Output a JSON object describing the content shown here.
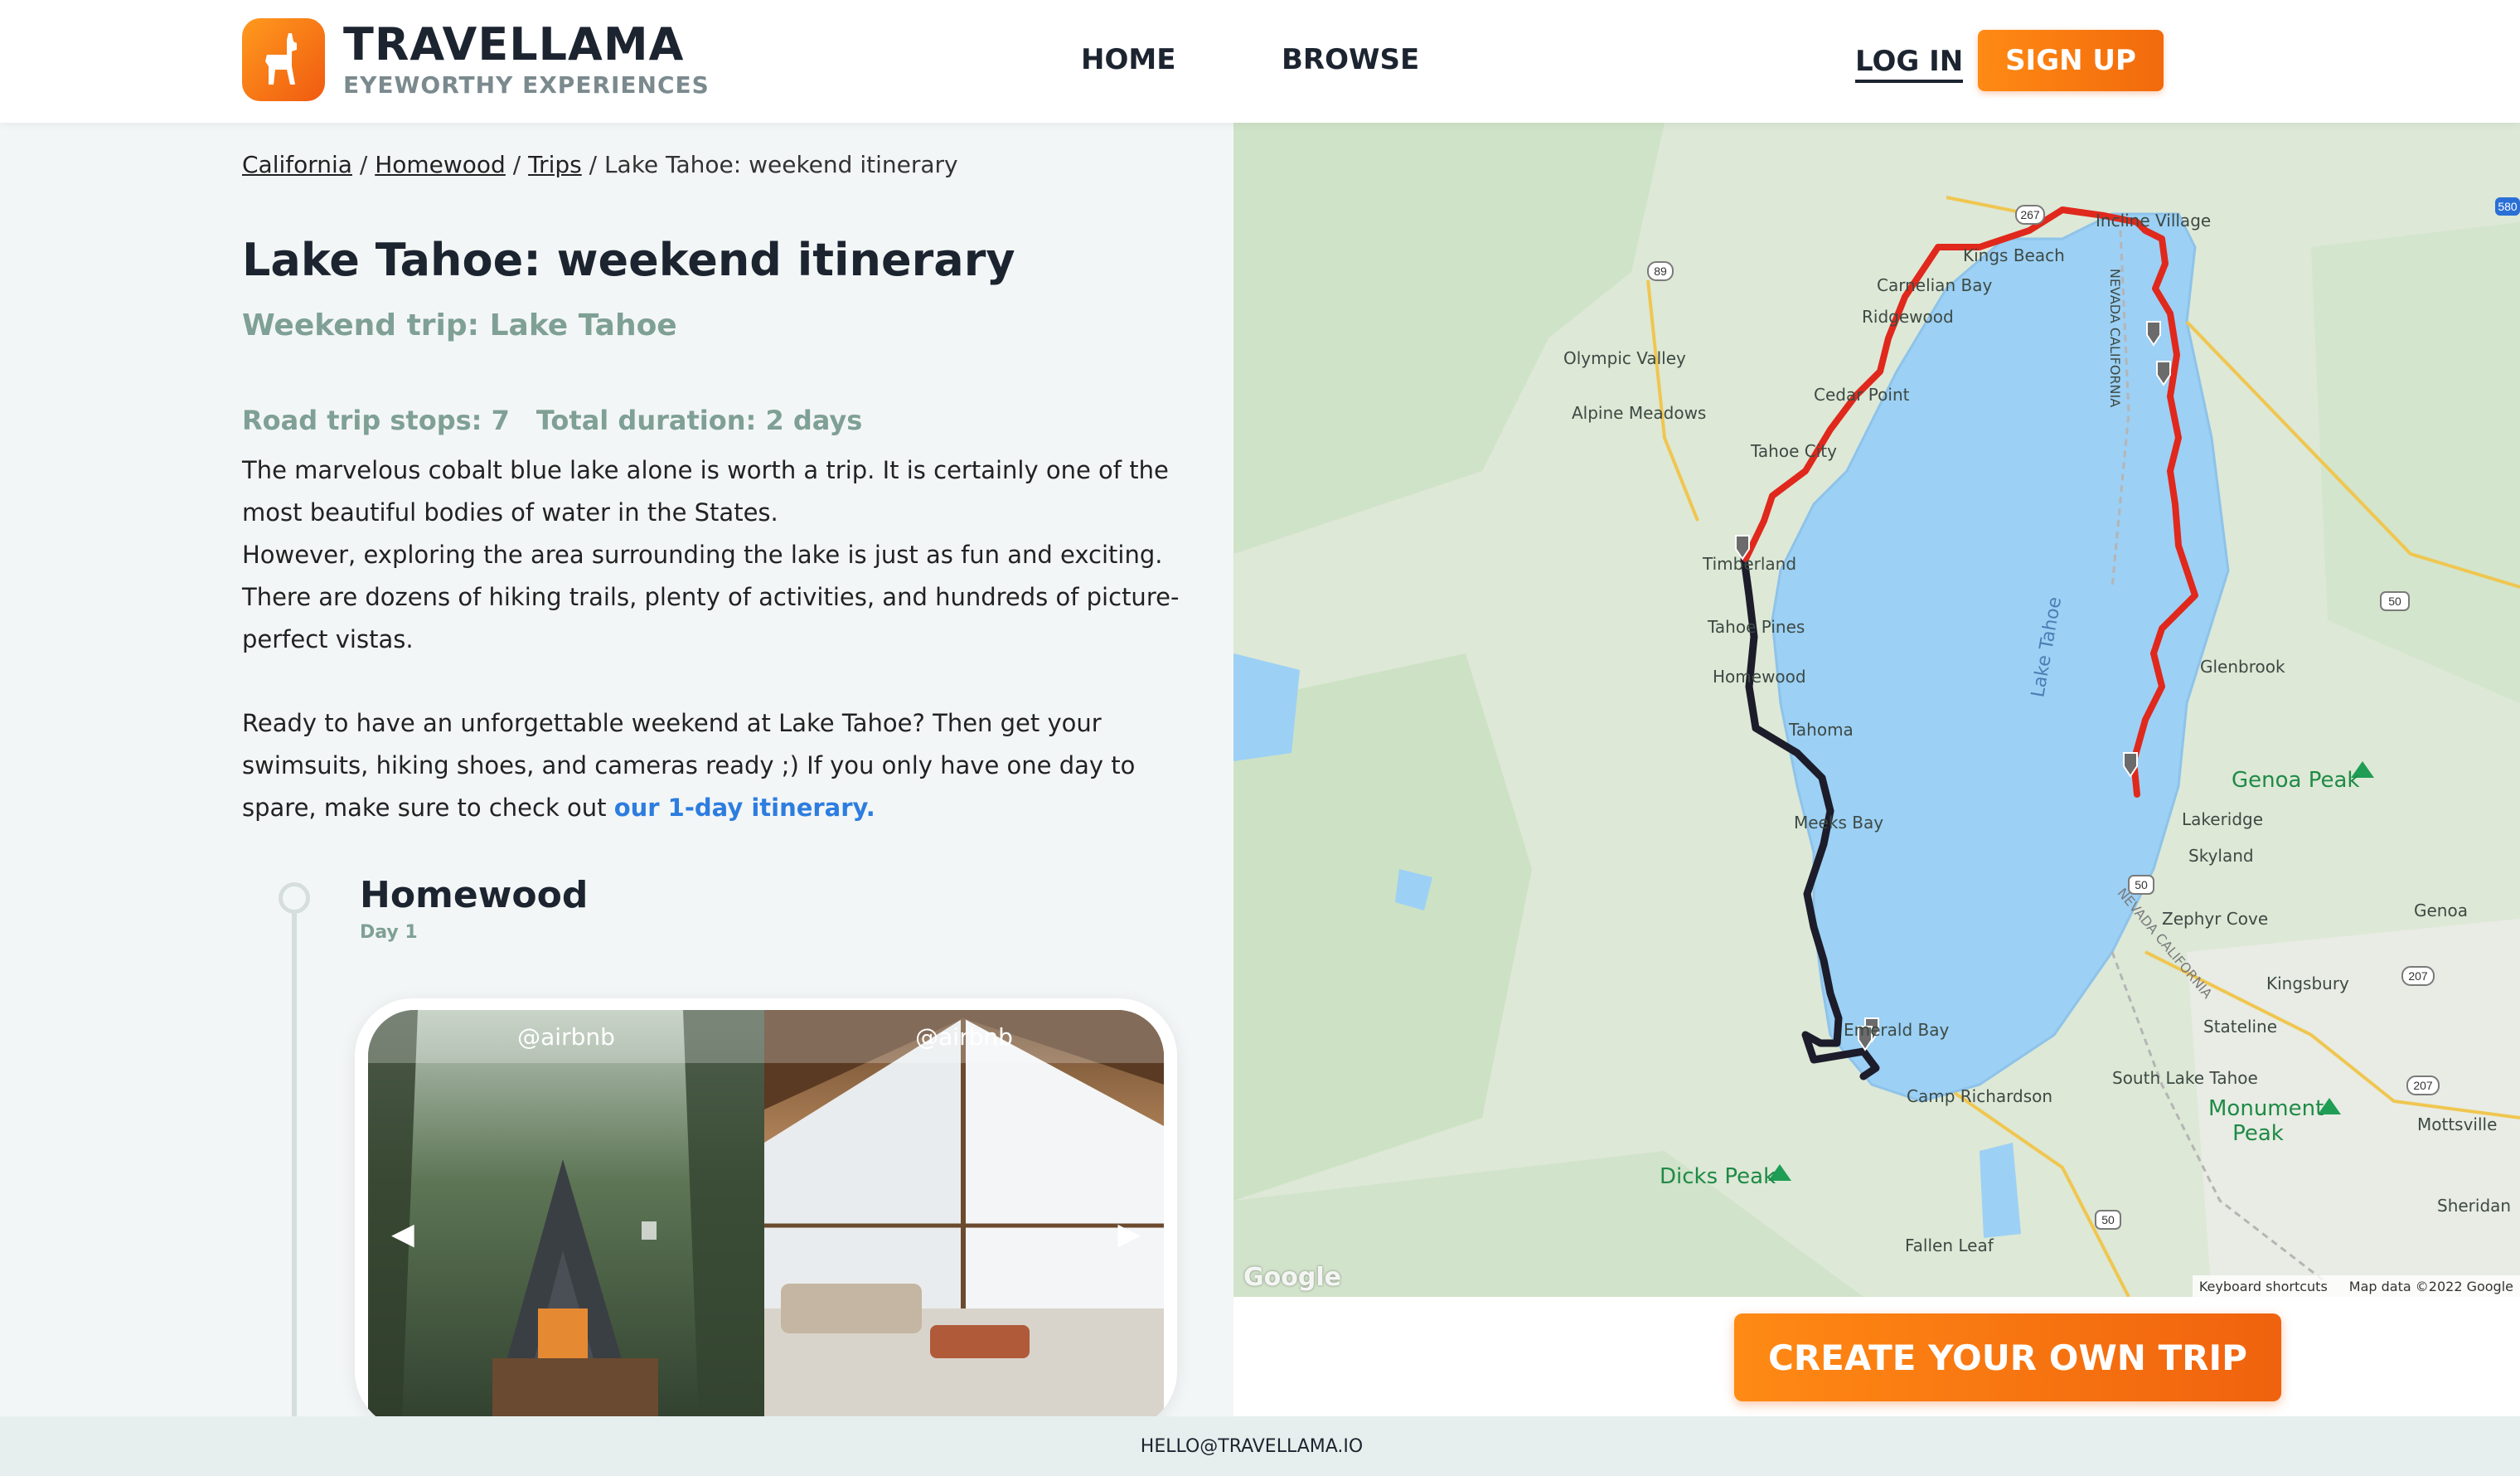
{
  "brand": {
    "name": "TRAVELLAMA",
    "tagline": "EYEWORTHY EXPERIENCES"
  },
  "nav": {
    "home": "HOME",
    "browse": "BROWSE",
    "login": "LOG IN",
    "signup": "SIGN UP"
  },
  "breadcrumb": {
    "items": [
      "California",
      "Homewood",
      "Trips"
    ],
    "current": "Lake Tahoe: weekend itinerary",
    "sep": " / "
  },
  "page": {
    "title": "Lake Tahoe: weekend itinerary",
    "subtitle": "Weekend trip: Lake Tahoe",
    "stops_label": "Road trip stops: 7",
    "duration_label": "Total duration: 2 days",
    "desc1": "The marvelous cobalt blue lake alone is worth a trip. It is certainly one of the most beautiful bodies of water in the States.",
    "desc2": "However, exploring the area surrounding the lake is just as fun and exciting. There are dozens of hiking trails, plenty of activities, and hundreds of picture-perfect vistas.",
    "desc3": "Ready to have an unforgettable weekend at Lake Tahoe? Then get your swimsuits, hiking shoes, and cameras ready ;) If you only have one day to spare, make sure to check out ",
    "desc_link": "our 1-day itinerary."
  },
  "stop": {
    "name": "Homewood",
    "day": "Day 1",
    "photos": [
      {
        "credit": "@airbnb"
      },
      {
        "credit": "@airbnb"
      }
    ]
  },
  "map": {
    "labels": {
      "olympic_valley": "Olympic Valley",
      "alpine_meadows": "Alpine Meadows",
      "tahoe_city": "Tahoe City",
      "timberland": "Timberland",
      "tahoe_pines": "Tahoe Pines",
      "homewood": "Homewood",
      "tahoma": "Tahoma",
      "meeks_bay": "Meeks Bay",
      "emerald_bay": "Emerald Bay",
      "camp_richardson": "Camp Richardson",
      "dicks_peak": "Dicks Peak",
      "fallen_leaf": "Fallen Leaf",
      "south_lake_tahoe": "South Lake Tahoe",
      "stateline": "Stateline",
      "kingsbury": "Kingsbury",
      "zephyr_cove": "Zephyr Cove",
      "skyland": "Skyland",
      "lakeridge": "Lakeridge",
      "genoa_peak": "Genoa Peak",
      "glenbrook": "Glenbrook",
      "genoa": "Genoa",
      "mottsville": "Mottsville",
      "sheridan": "Sheridan",
      "monument_peak": "Monument Peak",
      "carnelian_bay": "Carnelian Bay",
      "ridgewood": "Ridgewood",
      "cedar_point": "Cedar Point",
      "kings_beach": "Kings Beach",
      "incline_village": "Incline Village",
      "lake_tahoe": "Lake Tahoe",
      "nevada_california": "NEVADA CALIFORNIA",
      "nevada_california_2": "NEVADA CALIFORNIA"
    },
    "shields": [
      "267",
      "89",
      "50",
      "50",
      "207",
      "207",
      "50",
      "580"
    ],
    "google": "Google",
    "shortcuts": "Keyboard shortcuts",
    "attribution": "Map data ©2022 Google",
    "route_colors": {
      "day1": "#1c1c2a",
      "day2": "#e0281c"
    }
  },
  "cta": {
    "label": "CREATE YOUR OWN TRIP"
  },
  "footer": {
    "email": "HELLO@TRAVELLAMA.IO"
  }
}
